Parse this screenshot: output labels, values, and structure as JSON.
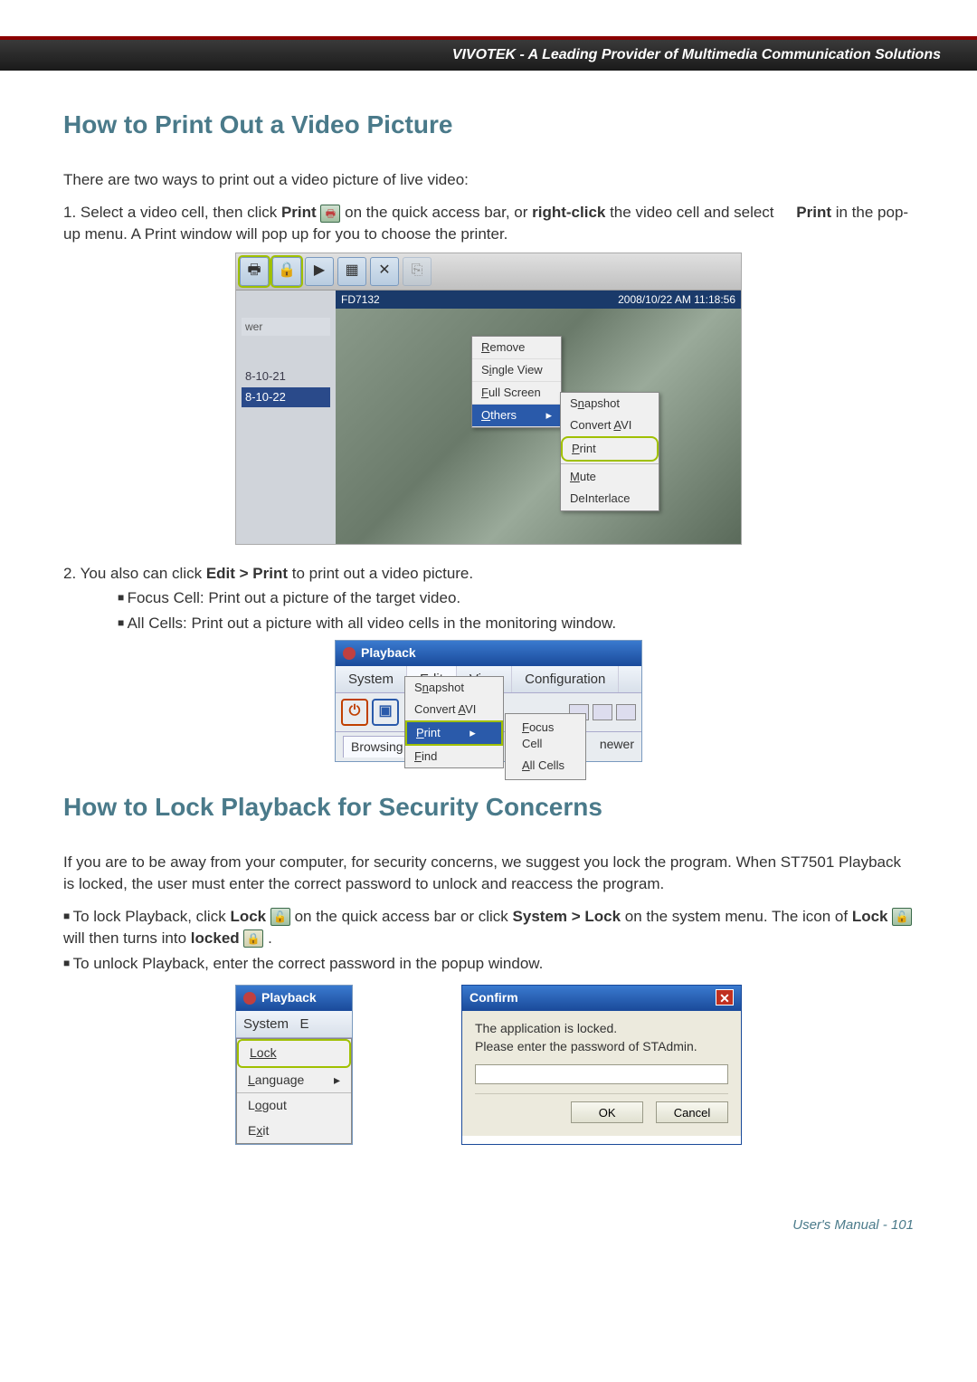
{
  "header": "VIVOTEK - A Leading Provider of Multimedia Communication Solutions",
  "section1": {
    "title": "How to Print Out a Video Picture",
    "intro": "There are two ways to print out a video picture of live video:",
    "step1_a": "1. Select a video cell, then click ",
    "step1_print": "Print",
    "step1_b": " on the quick access bar, or ",
    "step1_rc": "right-click",
    "step1_c": " the video cell and select ",
    "step1_d": " in the pop-up menu. A Print window will pop up for you to choose the printer.",
    "step2_a": "2. You also can click ",
    "step2_ep": "Edit > Print",
    "step2_b": " to print out a video picture.",
    "bullet_focus": "Focus Cell: Print out a picture of the target video.",
    "bullet_all": "All Cells: Print out a picture with all video cells in the monitoring window."
  },
  "shot1": {
    "left_header": "wer",
    "date1": "8-10-21",
    "date2": "8-10-22",
    "cam": "FD7132",
    "timestamp": "2008/10/22 AM 11:18:56",
    "ctx": {
      "remove": "Remove",
      "single": "Single View",
      "full": "Full Screen",
      "others": "Others",
      "snapshot": "Snapshot",
      "convert": "Convert AVI",
      "print": "Print",
      "mute": "Mute",
      "deinterlace": "DeInterlace"
    }
  },
  "shot2": {
    "title": "Playback",
    "menu": {
      "system": "System",
      "edit": "Edit",
      "view": "View",
      "config": "Configuration"
    },
    "drop": {
      "snapshot": "Snapshot",
      "convert": "Convert AVI",
      "print": "Print",
      "find": "Find"
    },
    "sub": {
      "focus": "Focus Cell",
      "all": "All Cells"
    },
    "browsing": "Browsing",
    "e": "E",
    "newer": "newer"
  },
  "section2": {
    "title": "How to Lock Playback for Security Concerns",
    "p1": "If you are to be away from your computer, for security concerns, we suggest you lock the program. When ST7501 Playback is locked, the user must enter the correct password to unlock and reaccess the program.",
    "b1a": "To lock Playback, click ",
    "b1lock": "Lock",
    "b1b": " on the quick access bar or click ",
    "b1sl": "System > Lock",
    "b1c": " on the system menu. The icon of ",
    "b1d": " will then turns into ",
    "b1locked": "locked",
    "b1e": " .",
    "b2": "To unlock Playback, enter the correct password in the popup window."
  },
  "sysmenu": {
    "title": "Playback",
    "system": "System",
    "e": "E",
    "lock": "Lock",
    "language": "Language",
    "logout": "Logout",
    "exit": "Exit"
  },
  "confirm": {
    "title": "Confirm",
    "line1": "The application is locked.",
    "line2": "Please enter the password of STAdmin.",
    "ok": "OK",
    "cancel": "Cancel"
  },
  "footer_a": "User's Manual - ",
  "footer_b": "101"
}
